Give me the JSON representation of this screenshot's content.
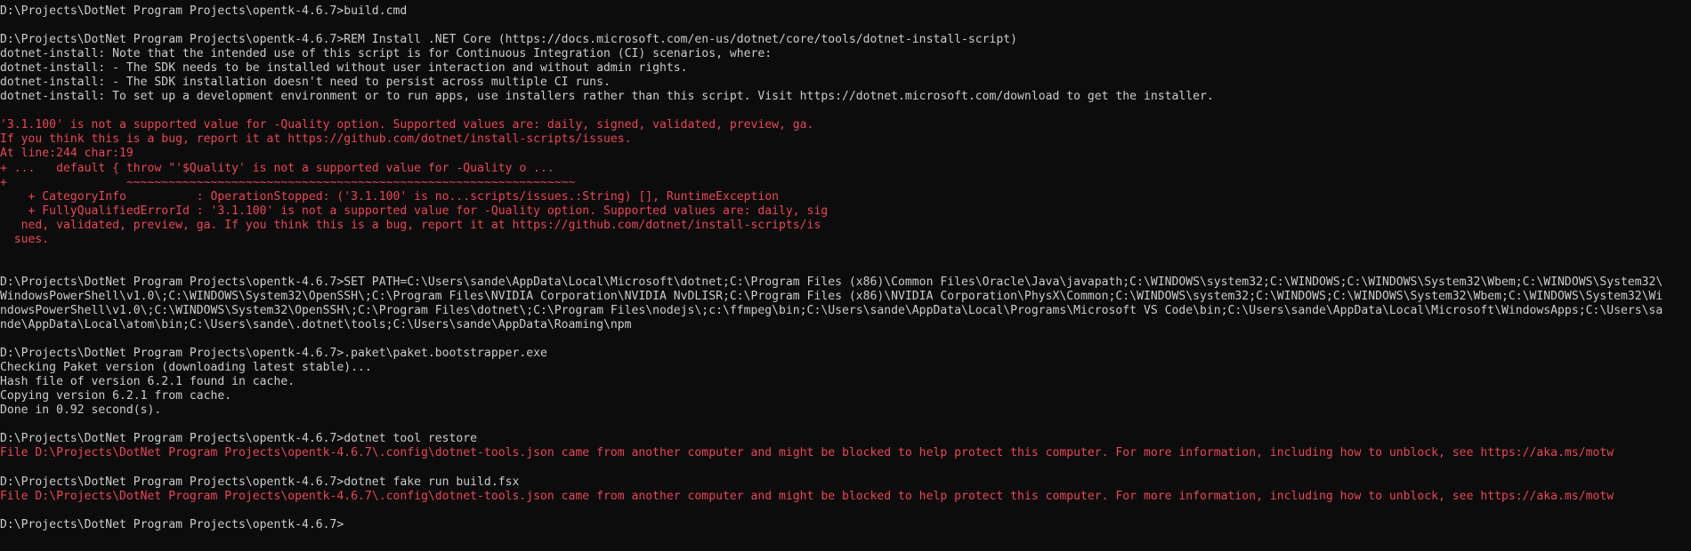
{
  "colors": {
    "background": "#0c0c0c",
    "text": "#cccccc",
    "error": "#e74856"
  },
  "lines": [
    {
      "text": "D:\\Projects\\DotNet Program Projects\\opentk-4.6.7>build.cmd",
      "style": "normal"
    },
    {
      "text": "",
      "style": "normal"
    },
    {
      "text": "D:\\Projects\\DotNet Program Projects\\opentk-4.6.7>REM Install .NET Core (https://docs.microsoft.com/en-us/dotnet/core/tools/dotnet-install-script)",
      "style": "normal"
    },
    {
      "text": "dotnet-install: Note that the intended use of this script is for Continuous Integration (CI) scenarios, where:",
      "style": "normal"
    },
    {
      "text": "dotnet-install: - The SDK needs to be installed without user interaction and without admin rights.",
      "style": "normal"
    },
    {
      "text": "dotnet-install: - The SDK installation doesn't need to persist across multiple CI runs.",
      "style": "normal"
    },
    {
      "text": "dotnet-install: To set up a development environment or to run apps, use installers rather than this script. Visit https://dotnet.microsoft.com/download to get the installer.",
      "style": "normal"
    },
    {
      "text": "",
      "style": "normal"
    },
    {
      "text": "'3.1.100' is not a supported value for -Quality option. Supported values are: daily, signed, validated, preview, ga.",
      "style": "err"
    },
    {
      "text": "If you think this is a bug, report it at https://github.com/dotnet/install-scripts/issues.",
      "style": "err"
    },
    {
      "text": "At line:244 char:19",
      "style": "err"
    },
    {
      "text": "+ ...   default { throw \"'$Quality' is not a supported value for -Quality o ...",
      "style": "err"
    },
    {
      "text": "+                 ~~~~~~~~~~~~~~~~~~~~~~~~~~~~~~~~~~~~~~~~~~~~~~~~~~~~~~~~~~~~~~~~",
      "style": "err"
    },
    {
      "text": "    + CategoryInfo          : OperationStopped: ('3.1.100' is no...scripts/issues.:String) [], RuntimeException",
      "style": "err"
    },
    {
      "text": "    + FullyQualifiedErrorId : '3.1.100' is not a supported value for -Quality option. Supported values are: daily, sig",
      "style": "err"
    },
    {
      "text": "   ned, validated, preview, ga. If you think this is a bug, report it at https://github.com/dotnet/install-scripts/is",
      "style": "err"
    },
    {
      "text": "  sues.",
      "style": "err"
    },
    {
      "text": "",
      "style": "normal"
    },
    {
      "text": "",
      "style": "normal"
    },
    {
      "text": "D:\\Projects\\DotNet Program Projects\\opentk-4.6.7>SET PATH=C:\\Users\\sande\\AppData\\Local\\Microsoft\\dotnet;C:\\Program Files (x86)\\Common Files\\Oracle\\Java\\javapath;C:\\WINDOWS\\system32;C:\\WINDOWS;C:\\WINDOWS\\System32\\Wbem;C:\\WINDOWS\\System32\\",
      "style": "normal"
    },
    {
      "text": "WindowsPowerShell\\v1.0\\;C:\\WINDOWS\\System32\\OpenSSH\\;C:\\Program Files\\NVIDIA Corporation\\NVIDIA NvDLISR;C:\\Program Files (x86)\\NVIDIA Corporation\\PhysX\\Common;C:\\WINDOWS\\system32;C:\\WINDOWS;C:\\WINDOWS\\System32\\Wbem;C:\\WINDOWS\\System32\\Wi",
      "style": "normal"
    },
    {
      "text": "ndowsPowerShell\\v1.0\\;C:\\WINDOWS\\System32\\OpenSSH\\;C:\\Program Files\\dotnet\\;C:\\Program Files\\nodejs\\;c:\\ffmpeg\\bin;C:\\Users\\sande\\AppData\\Local\\Programs\\Microsoft VS Code\\bin;C:\\Users\\sande\\AppData\\Local\\Microsoft\\WindowsApps;C:\\Users\\sa",
      "style": "normal"
    },
    {
      "text": "nde\\AppData\\Local\\atom\\bin;C:\\Users\\sande\\.dotnet\\tools;C:\\Users\\sande\\AppData\\Roaming\\npm",
      "style": "normal"
    },
    {
      "text": "",
      "style": "normal"
    },
    {
      "text": "D:\\Projects\\DotNet Program Projects\\opentk-4.6.7>.paket\\paket.bootstrapper.exe",
      "style": "normal"
    },
    {
      "text": "Checking Paket version (downloading latest stable)...",
      "style": "normal"
    },
    {
      "text": "Hash file of version 6.2.1 found in cache.",
      "style": "normal"
    },
    {
      "text": "Copying version 6.2.1 from cache.",
      "style": "normal"
    },
    {
      "text": "Done in 0.92 second(s).",
      "style": "normal"
    },
    {
      "text": "",
      "style": "normal"
    },
    {
      "text": "D:\\Projects\\DotNet Program Projects\\opentk-4.6.7>dotnet tool restore",
      "style": "normal"
    },
    {
      "text": "File D:\\Projects\\DotNet Program Projects\\opentk-4.6.7\\.config\\dotnet-tools.json came from another computer and might be blocked to help protect this computer. For more information, including how to unblock, see https://aka.ms/motw",
      "style": "err"
    },
    {
      "text": "",
      "style": "normal"
    },
    {
      "text": "D:\\Projects\\DotNet Program Projects\\opentk-4.6.7>dotnet fake run build.fsx",
      "style": "normal"
    },
    {
      "text": "File D:\\Projects\\DotNet Program Projects\\opentk-4.6.7\\.config\\dotnet-tools.json came from another computer and might be blocked to help protect this computer. For more information, including how to unblock, see https://aka.ms/motw",
      "style": "err"
    },
    {
      "text": "",
      "style": "normal"
    },
    {
      "text": "D:\\Projects\\DotNet Program Projects\\opentk-4.6.7>",
      "style": "normal"
    }
  ]
}
